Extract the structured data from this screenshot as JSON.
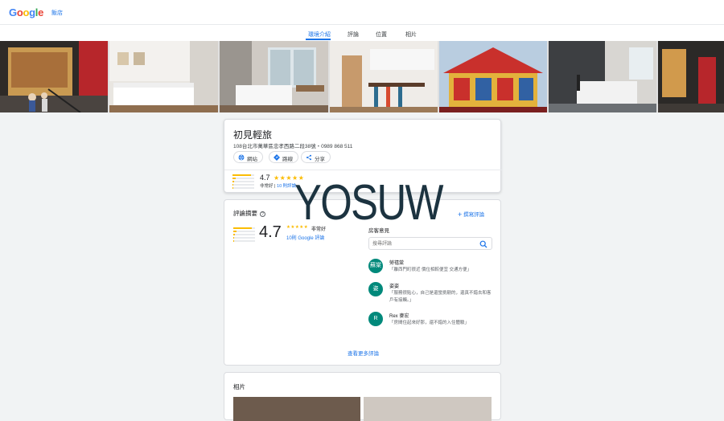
{
  "topbar": {
    "logo_letters": [
      {
        "char": "G",
        "color": "#4285f4"
      },
      {
        "char": "o",
        "color": "#ea4335"
      },
      {
        "char": "o",
        "color": "#fbbc04"
      },
      {
        "char": "g",
        "color": "#4285f4"
      },
      {
        "char": "l",
        "color": "#34a853"
      },
      {
        "char": "e",
        "color": "#ea4335"
      }
    ],
    "hotels_link": "飯店"
  },
  "tabs": [
    {
      "label": "環境介紹",
      "active": true
    },
    {
      "label": "評論",
      "active": false
    },
    {
      "label": "位置",
      "active": false
    },
    {
      "label": "相片",
      "active": false
    }
  ],
  "hotel": {
    "name": "初見輕旅",
    "address": "108台北市萬華區忠孝西路二段38號・0989 868 511",
    "actions": [
      {
        "label": "網站",
        "icon": "globe-icon"
      },
      {
        "label": "路線",
        "icon": "directions-icon"
      },
      {
        "label": "分享",
        "icon": "share-icon"
      }
    ],
    "rating": "4.7",
    "rating_stars": "★★★★★",
    "rating_word": "非常好",
    "review_count_link": "10 則評論",
    "separator": " | "
  },
  "review_summary": {
    "title": "評論摘要",
    "help_glyph": "?",
    "write_review": "撰寫評論",
    "write_review_icon": "plus-icon",
    "rating": "4.7",
    "stars": "★★★★★",
    "rating_word": "非常好",
    "review_count_link": "10則 Google 評論",
    "bar_fractions": [
      0.85,
      0.15,
      0.08,
      0.04,
      0.04
    ],
    "guest_opinions_title": "房客意見",
    "search_placeholder": "搜尋評論",
    "reviews": [
      {
        "initial": "蘇棠",
        "avatar_color": "#00897b",
        "name": "勞禧棠",
        "text": "「離西門町很近 價位相較便宜 交通方便」"
      },
      {
        "initial": "姿",
        "avatar_color": "#00897b",
        "name": "姿姿",
        "text": "「服務很貼心，自己是還蠻挑剔的，還真不錯去和客戶有接觸。」"
      },
      {
        "initial": "R",
        "avatar_color": "#00897b",
        "name": "Rex 麥宏",
        "text": "「房間住起來好那，還不錯的入住體驗」"
      }
    ],
    "more_reviews": "查看更多評論"
  },
  "photos_section": {
    "title": "相片"
  },
  "watermark": "YOSUW",
  "colors": {
    "accent": "#1a73e8",
    "star": "#fbbc04",
    "avatar": "#00897b"
  }
}
